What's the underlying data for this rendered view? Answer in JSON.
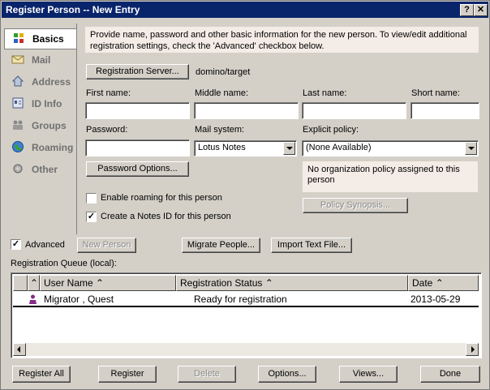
{
  "window": {
    "title": "Register Person -- New Entry",
    "help_btn": "?",
    "close_btn": "✕"
  },
  "sidebar": {
    "items": [
      {
        "label": "Basics",
        "icon": "basics-icon",
        "selected": true
      },
      {
        "label": "Mail",
        "icon": "mail-icon"
      },
      {
        "label": "Address",
        "icon": "address-icon"
      },
      {
        "label": "ID Info",
        "icon": "id-info-icon"
      },
      {
        "label": "Groups",
        "icon": "groups-icon"
      },
      {
        "label": "Roaming",
        "icon": "roaming-icon"
      },
      {
        "label": "Other",
        "icon": "other-icon"
      }
    ]
  },
  "info_text": "Provide name, password and other basic information for the new person.  To view/edit additional registration settings, check the 'Advanced' checkbox below.",
  "registration_server": {
    "button": "Registration Server...",
    "value": "domino/target"
  },
  "fields": {
    "first_name": {
      "label": "First name:",
      "value": ""
    },
    "middle_name": {
      "label": "Middle name:",
      "value": ""
    },
    "last_name": {
      "label": "Last name:",
      "value": ""
    },
    "short_name": {
      "label": "Short name:",
      "value": ""
    },
    "password": {
      "label": "Password:",
      "value": ""
    },
    "mail_system": {
      "label": "Mail system:",
      "value": "Lotus Notes"
    },
    "explicit_policy": {
      "label": "Explicit policy:",
      "value": "(None Available)"
    }
  },
  "password_options_btn": "Password Options...",
  "policy_text": "No organization policy assigned to this person",
  "policy_synopsis_btn": "Policy Synopsis...",
  "checkboxes": {
    "enable_roaming": {
      "label": "Enable roaming for this person",
      "checked": false
    },
    "create_notes_id": {
      "label": "Create a Notes ID for this person",
      "checked": true
    },
    "advanced": {
      "label": "Advanced",
      "checked": true
    }
  },
  "actions": {
    "new_person": "New Person",
    "migrate_people": "Migrate People...",
    "import_text_file": "Import Text File..."
  },
  "queue": {
    "label": "Registration Queue (local):",
    "columns": [
      "User Name",
      "Registration Status",
      "Date"
    ],
    "rows": [
      {
        "user": "Migrator , Quest",
        "status": "Ready for registration",
        "date": "2013-05-29"
      }
    ]
  },
  "footer": {
    "register_all": "Register All",
    "register": "Register",
    "delete": "Delete",
    "options": "Options...",
    "views": "Views...",
    "done": "Done"
  }
}
